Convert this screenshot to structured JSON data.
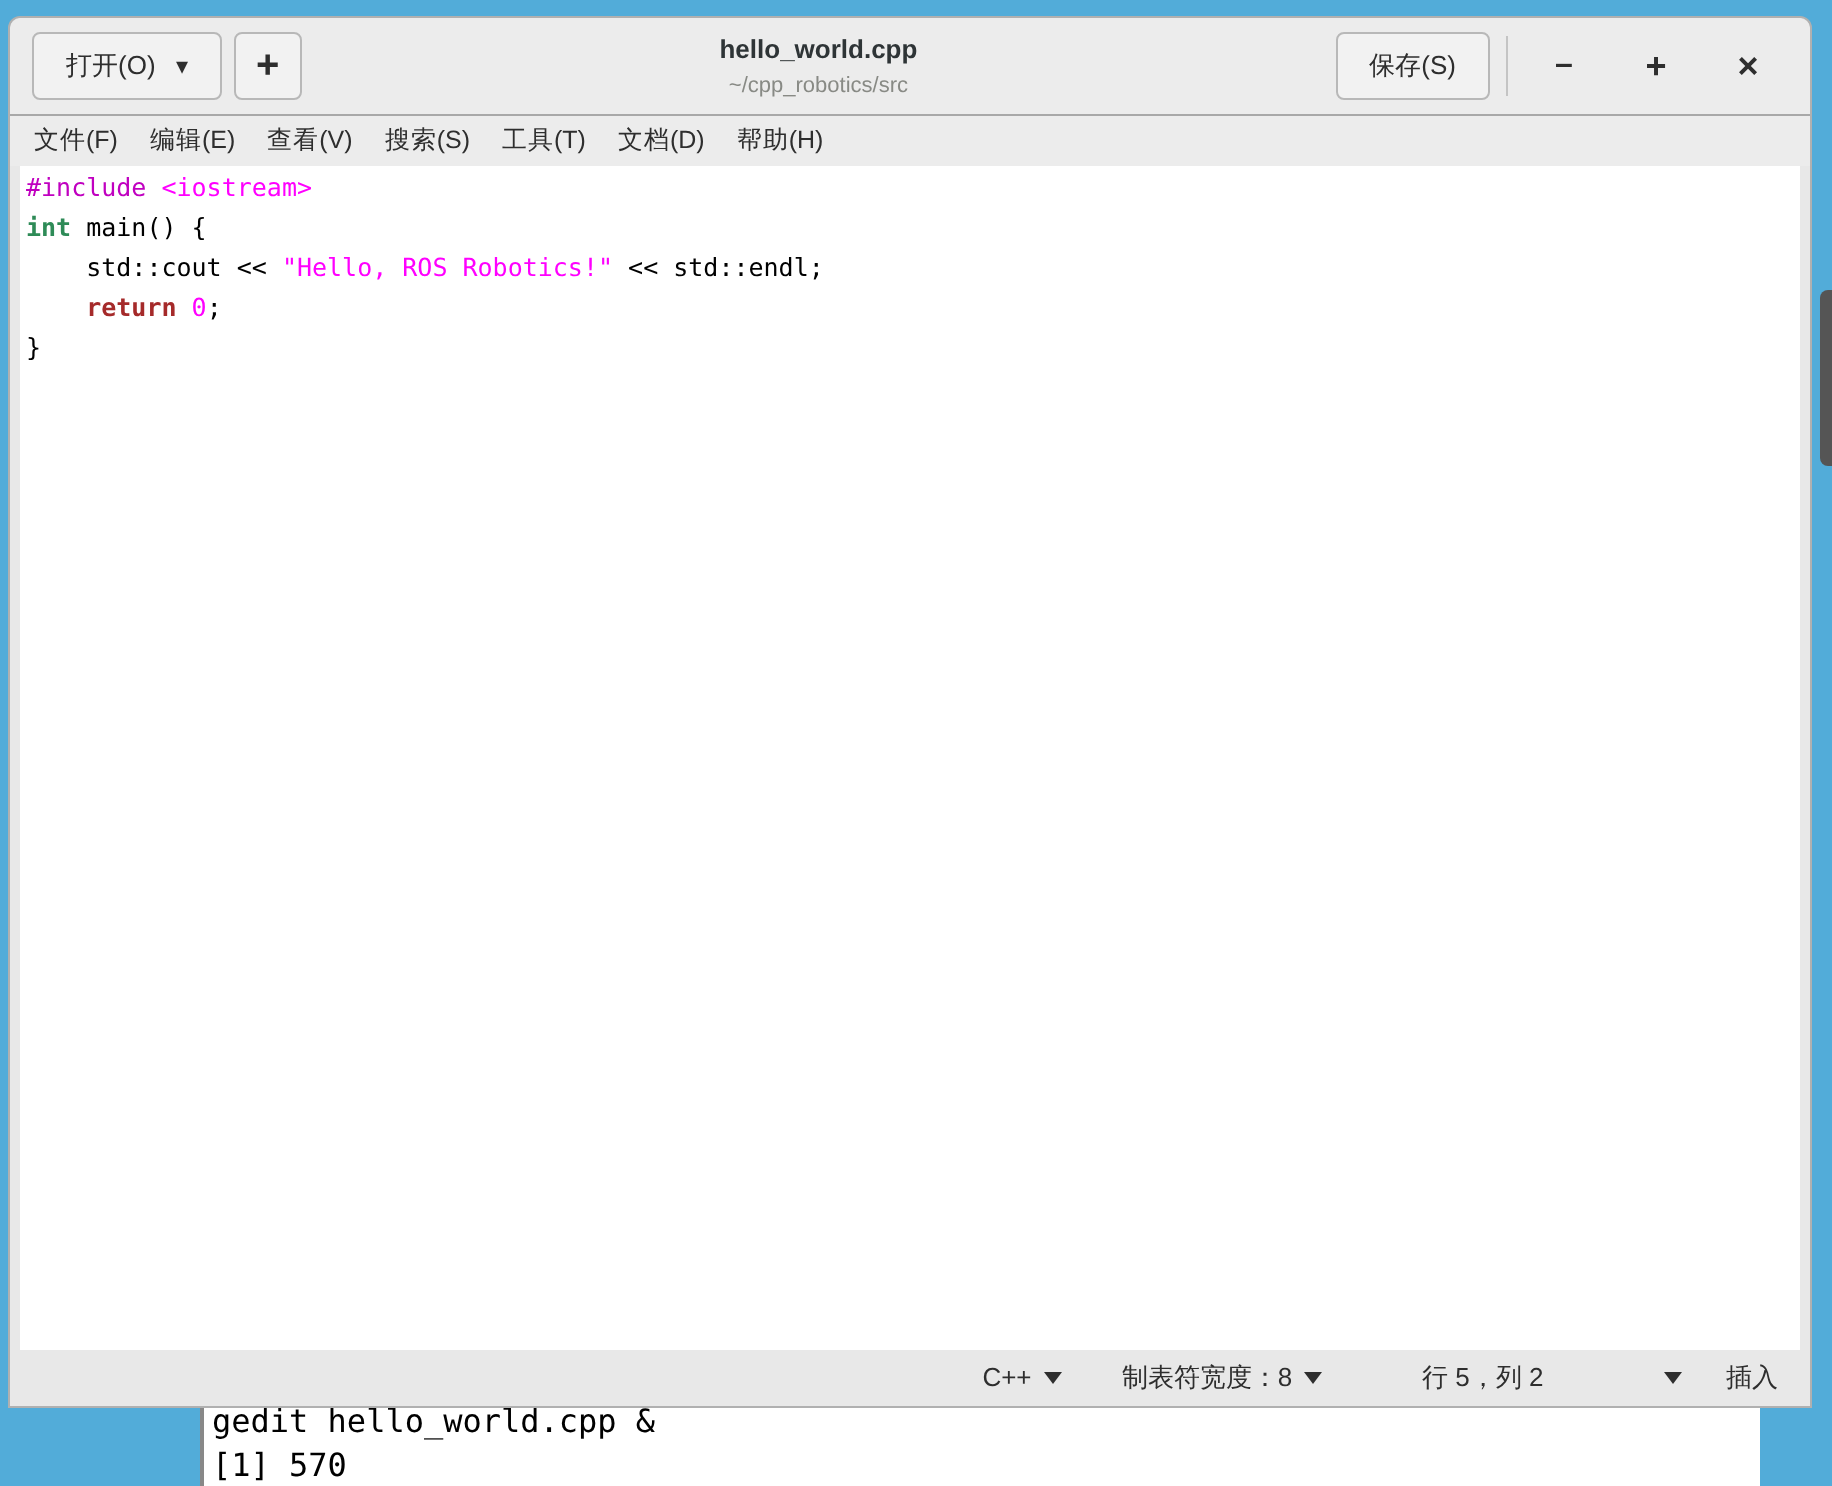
{
  "window": {
    "title": "hello_world.cpp",
    "subtitle": "~/cpp_robotics/src"
  },
  "header_buttons": {
    "open": "打开(O)",
    "open_caret": "▾",
    "new_tab": "+",
    "save": "保存(S)",
    "minimize": "–",
    "maximize": "+",
    "close": "×"
  },
  "menu": [
    "文件(F)",
    "编辑(E)",
    "查看(V)",
    "搜索(S)",
    "工具(T)",
    "文档(D)",
    "帮助(H)"
  ],
  "code_lines": [
    [
      {
        "kind": "preproc",
        "text": "#include "
      },
      {
        "kind": "string",
        "text": "<iostream>"
      }
    ],
    [
      {
        "kind": "type",
        "text": "int"
      },
      {
        "kind": "plain",
        "text": " main() {"
      }
    ],
    [
      {
        "kind": "plain",
        "text": "    std::cout << "
      },
      {
        "kind": "string",
        "text": "\"Hello, ROS Robotics!\""
      },
      {
        "kind": "plain",
        "text": " << std::endl;"
      }
    ],
    [
      {
        "kind": "statement",
        "text": "    return"
      },
      {
        "kind": "number",
        "text": " 0"
      },
      {
        "kind": "plain",
        "text": ";"
      }
    ],
    [
      {
        "kind": "plain",
        "text": "}"
      }
    ]
  ],
  "status_bar": {
    "language": "C++",
    "tab_width": "制表符宽度：8",
    "position": "行 5，列 2",
    "mode": "插入"
  },
  "terminal": [
    "gedit hello_world.cpp &",
    "[1] 570"
  ]
}
